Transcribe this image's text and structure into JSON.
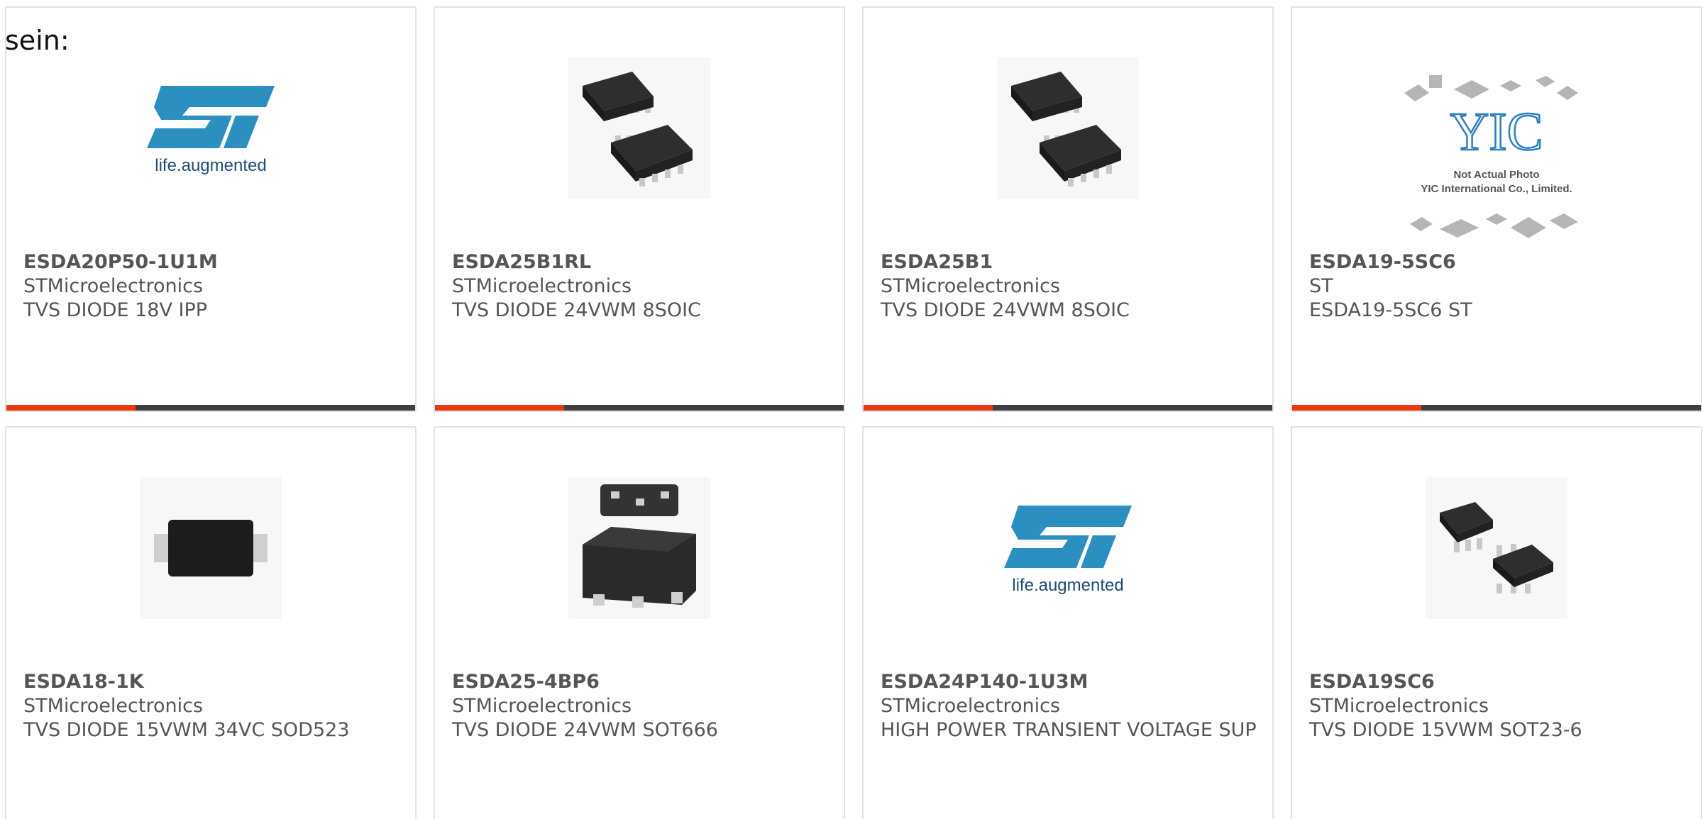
{
  "intro_text": "sein:",
  "colors": {
    "accent": "#e8380d",
    "bar": "#3f3f3f",
    "st_blue": "#2b8fc0"
  },
  "products": [
    {
      "part": "ESDA20P50-1U1M",
      "maker": "STMicroelectronics",
      "desc": "TVS DIODE 18V IPP",
      "image": "st-logo",
      "logo_tagline": "life.augmented"
    },
    {
      "part": "ESDA25B1RL",
      "maker": "STMicroelectronics",
      "desc": "TVS DIODE 24VWM 8SOIC",
      "image": "soic8-chip"
    },
    {
      "part": "ESDA25B1",
      "maker": "STMicroelectronics",
      "desc": "TVS DIODE 24VWM 8SOIC",
      "image": "soic8-chip"
    },
    {
      "part": "ESDA19-5SC6",
      "maker": "ST",
      "desc": "ESDA19-5SC6 ST",
      "image": "yic-placeholder",
      "placeholder_line1": "Not Actual Photo",
      "placeholder_line2": "YIC International Co., Limited."
    },
    {
      "part": "ESDA18-1K",
      "maker": "STMicroelectronics",
      "desc": "TVS DIODE 15VWM 34VC SOD523",
      "image": "sod523-chip"
    },
    {
      "part": "ESDA25-4BP6",
      "maker": "STMicroelectronics",
      "desc": "TVS DIODE 24VWM SOT666",
      "image": "sot666-chip"
    },
    {
      "part": "ESDA24P140-1U3M",
      "maker": "STMicroelectronics",
      "desc": "HIGH POWER TRANSIENT VOLTAGE SUP",
      "image": "st-logo",
      "logo_tagline": "life.augmented"
    },
    {
      "part": "ESDA19SC6",
      "maker": "STMicroelectronics",
      "desc": "TVS DIODE 15VWM SOT23-6",
      "image": "sot23-chip"
    }
  ]
}
